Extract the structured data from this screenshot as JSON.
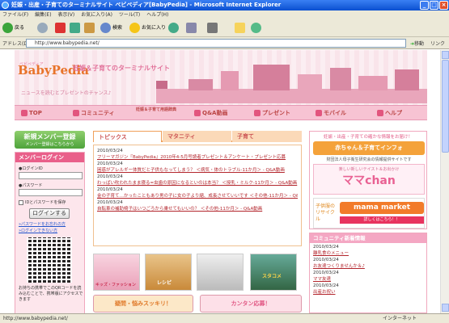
{
  "window": {
    "title": "妊娠・出産・子育てのターミナルサイト ベビペディア[BabyPedia] - Microsoft Internet Explorer"
  },
  "menu": [
    "ファイル(F)",
    "編集(E)",
    "表示(V)",
    "お気に入り(A)",
    "ツール(T)",
    "ヘルプ(H)"
  ],
  "toolbar": {
    "back": "戻る",
    "search": "検索",
    "favorites": "お気に入り"
  },
  "address": {
    "label": "アドレス(D)",
    "url": "http://www.babypedia.net/",
    "go": "移動",
    "links": "リンク"
  },
  "header": {
    "logo": "BabyPedia",
    "logo_sub": "ベビペディア",
    "tagline": "妊娠＆子育てのターミナルサイト",
    "slogan": "ニュースを読むとプレゼントのチャンス♪"
  },
  "nav": [
    "TOP",
    "コミュニティ",
    "妊娠＆子育て用語辞典",
    "Q&A動画",
    "プレゼント",
    "モバイル",
    "ヘルプ"
  ],
  "left": {
    "register": "新規メンバー登録",
    "register_sub": "メンバー登録はこちらから",
    "login_title": "メンバーログイン",
    "id_label": "●ログインID",
    "pw_label": "●パスワード",
    "save": "IDとパスワードを保存",
    "login_btn": "ログインする",
    "forgot": "»パスワードをお忘れの方",
    "help": "»ログインできない方",
    "qr_note": "お持ちの携帯でこのQRコードを読み込むことで、携帯版にアクセスできます"
  },
  "tabs": [
    "トピックス",
    "マタニティ",
    "子育て"
  ],
  "news": [
    {
      "date": "2010/03/24",
      "title": "フリーマガジン『BabyPedia』2010年4-5月号読者プレゼント＆アンケート・プレゼント応募"
    },
    {
      "date": "2010/03/24",
      "title": "困惑がアレルギー体質だと子供もなってしまう？ ＜病気・体のトラブル-11か月＞ - Q&A動画"
    },
    {
      "date": "2010/03/24",
      "title": "わっぱい吹われたまま寝る=虫歯の原因になるといのは本当？ ＜授乳・ミルク-11か月＞ - Q&A動画"
    },
    {
      "date": "2010/03/24",
      "title": "金の子育て…かったこともあり男の子に女の子より縮、成長させていいです ＜その他-11か月＞ - Q&A動画"
    },
    {
      "date": "2010/03/24",
      "title": "自転車の補助椅子はいつごろから乗せてもいいの？ ＜その他-11か月＞ - Q&A動画"
    }
  ],
  "thumbs": [
    "キッズ・ファッション",
    "レシピ",
    "",
    "スタコメ"
  ],
  "banners": [
    "疑問・悩みスッキリ！",
    "カンタン応募！"
  ],
  "right": {
    "header": "妊娠・出産・子育ての確かな情報をお届け！",
    "ad1": "赤ちゃん＆子育てインフォ",
    "ad1_sub": "財団法人母子衛生研究会の情報提供サイトです",
    "ad2_sub": "楽しい新しいテイスト＆お出かけ",
    "ad2": "ママchan",
    "ad3_left": "子供服のリサイクル",
    "ad3": "mama market",
    "ad3_btn": "詳しくはこちら！！",
    "comm_title": "コミュニティ新着情報",
    "comm": [
      {
        "date": "2010/03/24",
        "title": "離乳食のメニュー"
      },
      {
        "date": "2010/03/24",
        "title": "お友達つくりませんか＆♪"
      },
      {
        "date": "2010/03/24",
        "title": "ママ友達"
      },
      {
        "date": "2010/03/24",
        "title": "出産お祝い"
      }
    ]
  },
  "status": {
    "url": "http://www.babypedia.net/",
    "zone": "インターネット"
  }
}
